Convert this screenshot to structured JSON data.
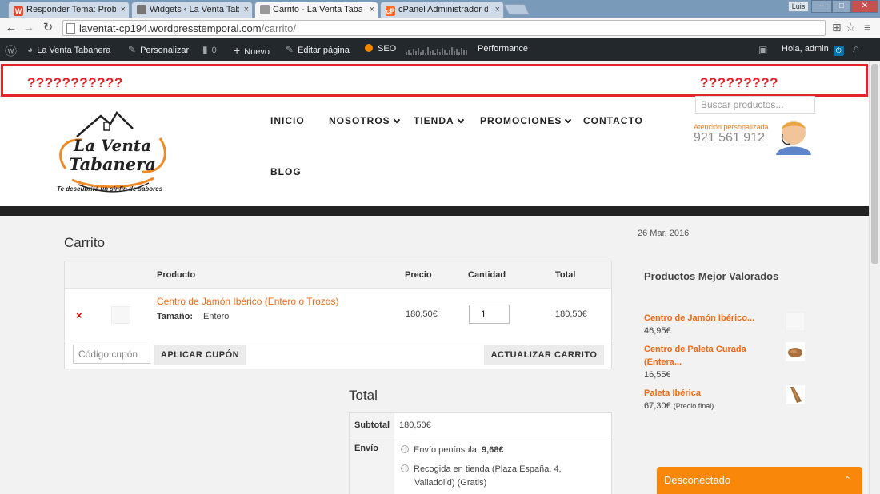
{
  "browser": {
    "tabs": [
      {
        "label": "Responder Tema: Problem",
        "fav": "W",
        "fav_color": "#e0492b"
      },
      {
        "label": "Widgets ‹ La Venta Taban",
        "fav": "",
        "fav_color": "#777777"
      },
      {
        "label": "Carrito - La Venta Tabane",
        "fav": "",
        "fav_color": "#999999"
      },
      {
        "label": "cPanel Administrador de c",
        "fav": "cP",
        "fav_color": "#ff6c2c"
      }
    ],
    "close_glyph": "×",
    "user_badge": "Luis",
    "window_buttons": [
      "–",
      "□",
      "✕"
    ],
    "url_host": "laventat-cp194.wordpresstemporal.com",
    "url_path": "/carrito/",
    "back": "←",
    "forward": "→",
    "reload": "↻",
    "translate": "⊞",
    "star": "☆",
    "menu": "≡"
  },
  "adminbar": {
    "wp_logo": "ⓦ",
    "site": "La Venta Tabanera",
    "customize": "Personalizar",
    "comments": "0",
    "new": "Nuevo",
    "edit": "Editar página",
    "seo": "SEO",
    "performance": "Performance",
    "greeting": "Hola, admin",
    "search": "⌕"
  },
  "placeholder_box": {
    "left": "???????????",
    "right": "?????????"
  },
  "header": {
    "logo_line1": "La Venta",
    "logo_line2": "Tabanera",
    "tagline": "Te descubrirá un sinfín de  sabores",
    "nav": [
      {
        "label": "INICIO",
        "dropdown": false
      },
      {
        "label": "NOSOTROS",
        "dropdown": true
      },
      {
        "label": "TIENDA",
        "dropdown": true
      },
      {
        "label": "PROMOCIONES",
        "dropdown": true
      },
      {
        "label": "CONTACTO",
        "dropdown": false
      },
      {
        "label": "BLOG",
        "dropdown": false
      }
    ],
    "search_placeholder": "Buscar productos...",
    "support_label": "Atención personalizada",
    "support_phone": "921 561 912"
  },
  "cart": {
    "title": "Carrito",
    "columns": {
      "product": "Producto",
      "price": "Precio",
      "qty": "Cantidad",
      "total": "Total"
    },
    "item": {
      "name": "Centro de Jamón Ibérico (Entero o Trozos)",
      "attr_label": "Tamaño:",
      "attr_value": "Entero",
      "price": "180,50€",
      "qty": "1",
      "total": "180,50€",
      "remove": "×"
    },
    "coupon_placeholder": "Código cupón",
    "apply_coupon": "APLICAR CUPÓN",
    "update_cart": "ACTUALIZAR CARRITO"
  },
  "totals": {
    "title": "Total",
    "subtotal_label": "Subtotal",
    "subtotal_value": "180,50€",
    "shipping_label": "Envío",
    "option1_text": "Envío península:",
    "option1_price": "9,68€",
    "option2_line1": "Recogida en tienda (Plaza España, 4,",
    "option2_line2": "Valladolid) (Gratis)"
  },
  "sidebar": {
    "date": "26 Mar, 2016",
    "title": "Productos Mejor Valorados",
    "items": [
      {
        "name1": "Centro de Jamón Ibérico...",
        "name2": "",
        "price": "46,95€",
        "price_note": ""
      },
      {
        "name1": "Centro de Paleta Curada",
        "name2": "(Entera...",
        "price": "16,55€",
        "price_note": ""
      },
      {
        "name1": "Paleta Ibérica",
        "name2": "",
        "price": "67,30€",
        "price_note": "(Precio final)"
      }
    ]
  },
  "chat": {
    "label": "Desconectado",
    "caret": "⌃"
  },
  "colors": {
    "accent": "#ef6a16",
    "admin_bg": "#23282d",
    "red_box": "#e2232a",
    "chat_bg": "#f98709"
  }
}
